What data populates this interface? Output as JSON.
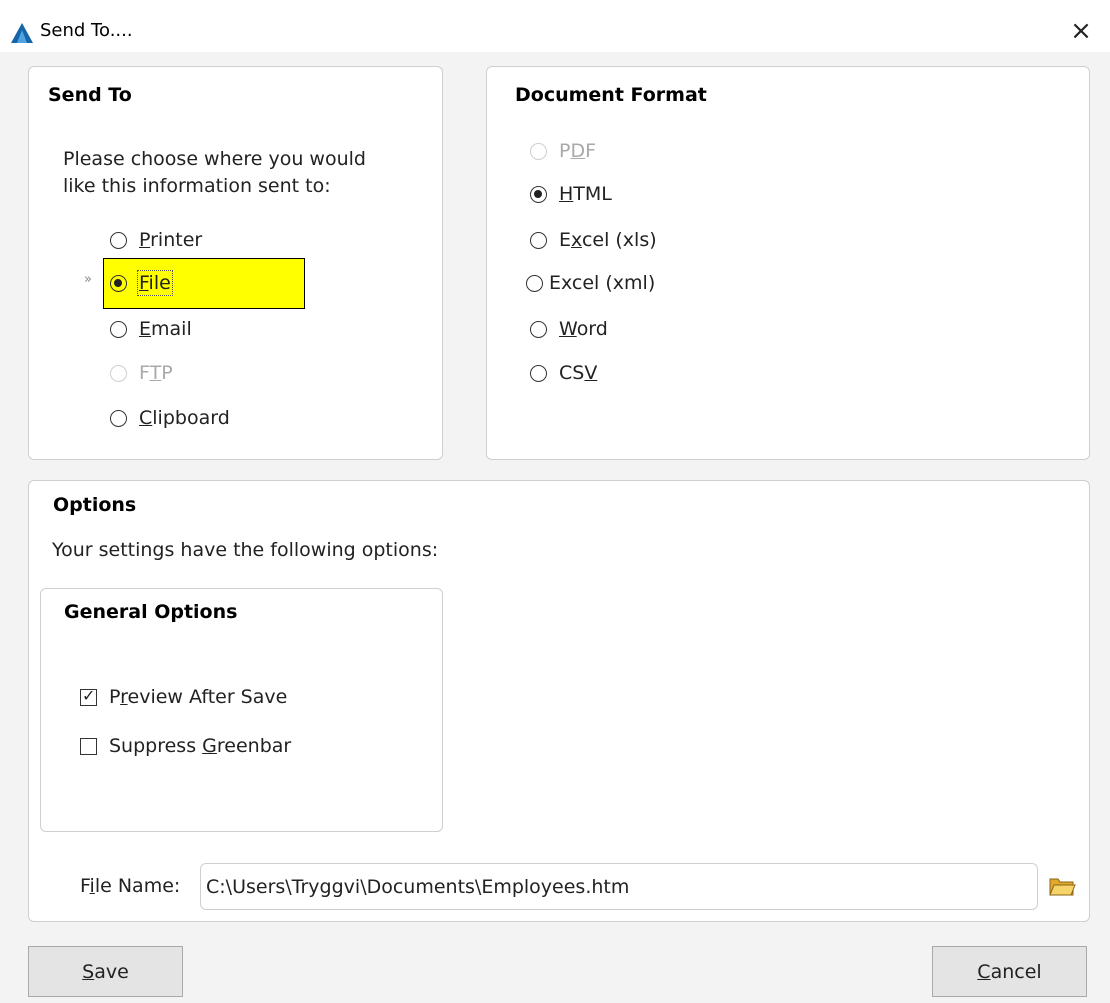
{
  "window": {
    "title": "Send To....",
    "close_glyph": "×",
    "accent_color": "#1565a8"
  },
  "send_to": {
    "title": "Send To",
    "description_line1": "Please choose where you would",
    "description_line2": "like this information sent to:",
    "options": [
      {
        "pre": "",
        "key": "P",
        "post": "rinter",
        "checked": false,
        "disabled": false
      },
      {
        "pre": "",
        "key": "F",
        "post": "ile",
        "checked": true,
        "disabled": false,
        "highlighted": true
      },
      {
        "pre": "",
        "key": "E",
        "post": "mail",
        "checked": false,
        "disabled": false
      },
      {
        "pre": "F",
        "key": "T",
        "post": "P",
        "checked": false,
        "disabled": true
      },
      {
        "pre": "",
        "key": "C",
        "post": "lipboard",
        "checked": false,
        "disabled": false
      }
    ],
    "highlight_color": "#ffff00",
    "pointer_glyph": "»"
  },
  "document_format": {
    "title": "Document Format",
    "options": [
      {
        "pre": "P",
        "key": "D",
        "post": "F",
        "checked": false,
        "disabled": true
      },
      {
        "pre": "",
        "key": "H",
        "post": "TML",
        "checked": true,
        "disabled": false
      },
      {
        "pre": "E",
        "key": "x",
        "post": "cel (xls)",
        "checked": false,
        "disabled": false
      },
      {
        "pre": "",
        "key": "",
        "post": "Excel (xml)",
        "checked": false,
        "disabled": false
      },
      {
        "pre": "",
        "key": "W",
        "post": "ord",
        "checked": false,
        "disabled": false
      },
      {
        "pre": "CS",
        "key": "V",
        "post": "",
        "checked": false,
        "disabled": false
      }
    ]
  },
  "options": {
    "title": "Options",
    "description": "Your settings have the following options:",
    "general": {
      "title": "General Options",
      "preview": {
        "pre": "P",
        "key": "r",
        "post": "eview After Save",
        "checked": true
      },
      "suppress": {
        "pre": "Suppress ",
        "key": "G",
        "post": "reenbar",
        "checked": false
      }
    },
    "file_name": {
      "label_pre": "F",
      "label_key": "i",
      "label_post": "le Name:",
      "value": "C:\\Users\\Tryggvi\\Documents\\Employees.htm"
    }
  },
  "buttons": {
    "save": {
      "key": "S",
      "post": "ave"
    },
    "cancel": {
      "key": "C",
      "post": "ancel"
    }
  },
  "icons": {
    "app": "app-logo-icon",
    "close": "close-icon",
    "folder": "folder-open-icon",
    "checkmark": "checkmark-icon"
  }
}
